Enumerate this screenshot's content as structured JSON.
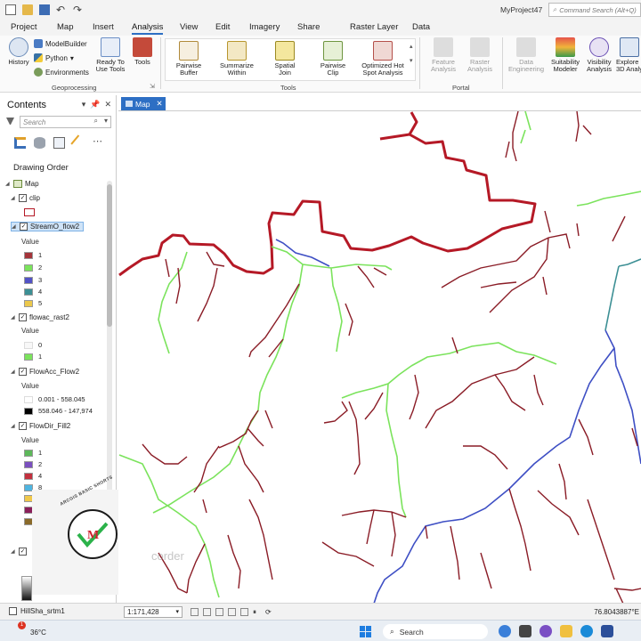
{
  "titlebar": {
    "project_title": "MyProject47",
    "command_search_placeholder": "Command Search (Alt+Q)"
  },
  "menu": {
    "items": [
      "Project",
      "Map",
      "Insert",
      "Analysis",
      "View",
      "Edit",
      "Imagery",
      "Share",
      "Raster Layer",
      "Data"
    ],
    "active": "Analysis"
  },
  "ribbon": {
    "geoprocessing": {
      "label": "Geoprocessing",
      "history": "History",
      "model_builder": "ModelBuilder",
      "python": "Python",
      "environments": "Environments",
      "ready_to_use_1": "Ready To",
      "ready_to_use_2": "Use Tools",
      "tools": "Tools"
    },
    "tools_group": {
      "label": "Tools",
      "items": [
        {
          "line1": "Pairwise",
          "line2": "Buffer"
        },
        {
          "line1": "Summarize",
          "line2": "Within"
        },
        {
          "line1": "Spatial",
          "line2": "Join"
        },
        {
          "line1": "Pairwise",
          "line2": "Clip"
        },
        {
          "line1": "Optimized Hot",
          "line2": "Spot Analysis"
        }
      ]
    },
    "portal": {
      "label": "Portal",
      "feature_1": "Feature",
      "feature_2": "Analysis",
      "raster_1": "Raster",
      "raster_2": "Analysis"
    },
    "workflows": {
      "data_eng_1": "Data",
      "data_eng_2": "Engineering",
      "suitability_1": "Suitability",
      "suitability_2": "Modeler",
      "visibility_1": "Visibility",
      "visibility_2": "Analysis",
      "explore_1": "Explore",
      "explore_2": "3D Analy"
    }
  },
  "contents": {
    "title": "Contents",
    "search_placeholder": "Search",
    "drawing_order": "Drawing Order",
    "map_label": "Map",
    "layers": {
      "clip": "clip",
      "stream": "StreamO_flow2",
      "flowac": "flowac_rast2",
      "flowacc": "FlowAcc_Flow2",
      "flowdir": "FlowDir_Fill2",
      "hillsha": "HillSha_srtm1"
    },
    "value_label": "Value",
    "stream_values": [
      "1",
      "2",
      "3",
      "4",
      "5"
    ],
    "flowac_values": [
      "0",
      "1"
    ],
    "flowacc_ranges": [
      "0.001 - 558.045",
      "558.046 - 147,974"
    ],
    "flowdir_values": [
      "1",
      "2",
      "4",
      "8"
    ],
    "colors": {
      "stream_1": "#a4343a",
      "stream_2": "#7be35c",
      "stream_3": "#5252c6",
      "stream_4": "#3c8f94",
      "stream_5": "#ebc84c",
      "clip_outline": "#b51926"
    }
  },
  "logo": {
    "ring_text": "ARCGIS BASIC SHORTS",
    "mark": "M"
  },
  "map": {
    "tab_label": "Map",
    "watermark": "corder"
  },
  "status": {
    "scale": "1:171,428",
    "coordinates": "76.8043887°E"
  },
  "taskbar": {
    "temperature": "36°C",
    "badge": "1",
    "search_label": "Search"
  }
}
